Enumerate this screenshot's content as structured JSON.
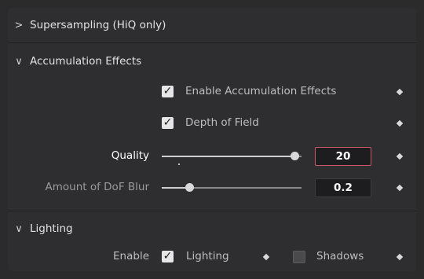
{
  "sections": {
    "supersampling": {
      "title": "Supersampling (HiQ only)",
      "chevron": ">"
    },
    "accumulation": {
      "title": "Accumulation Effects",
      "chevron": "∨"
    },
    "lighting": {
      "title": "Lighting",
      "chevron": "∨"
    }
  },
  "accumulation": {
    "enable": {
      "label": "Enable Accumulation Effects",
      "checked": true
    },
    "dof": {
      "label": "Depth of Field",
      "checked": true
    },
    "quality": {
      "label": "Quality",
      "value": "20",
      "slider_fraction": 0.95
    },
    "dof_blur": {
      "label": "Amount of DoF Blur",
      "value": "0.2",
      "slider_fraction": 0.2
    }
  },
  "lighting": {
    "enable_label": "Enable",
    "lighting": {
      "label": "Lighting",
      "checked": true
    },
    "shadows": {
      "label": "Shadows",
      "checked": false
    }
  },
  "icons": {
    "check": "✓",
    "keyframe": "diamond-icon"
  },
  "colors": {
    "active_border": "#c95a6a",
    "panel": "#2e2e31",
    "field": "#1d1d1f"
  }
}
